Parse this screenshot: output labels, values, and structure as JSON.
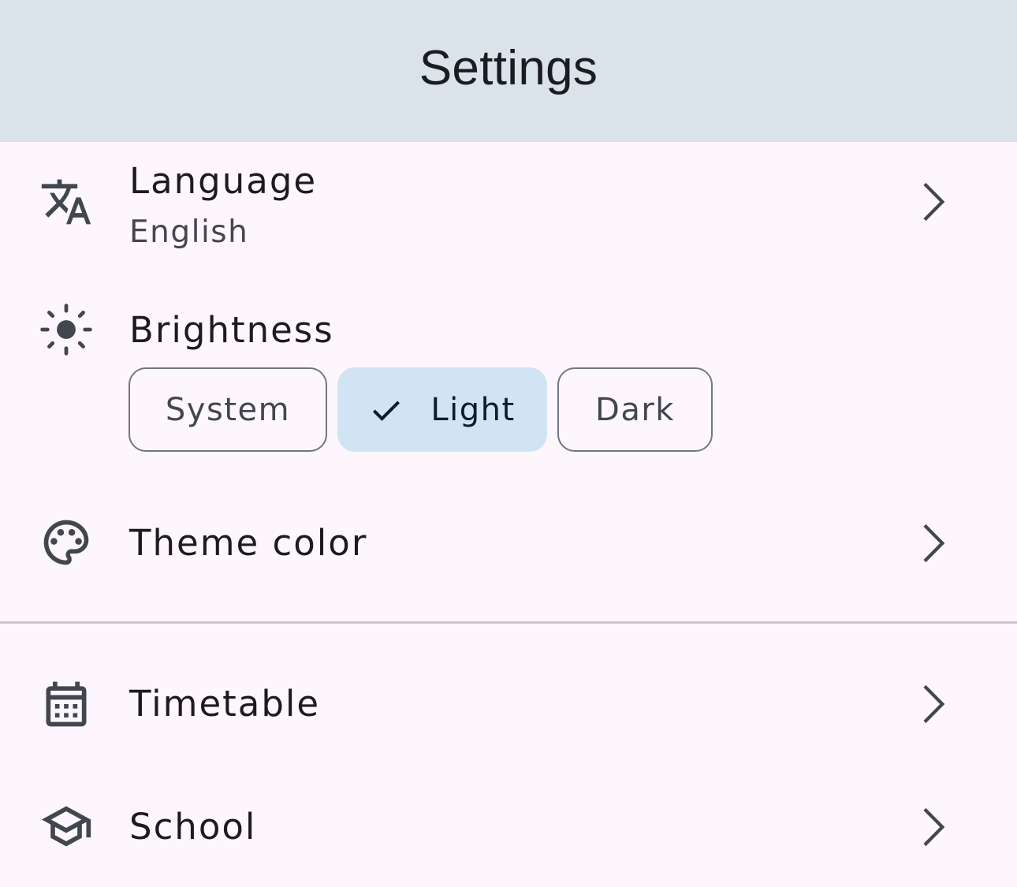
{
  "topbar": {
    "title": "Settings"
  },
  "rows": {
    "language": {
      "title": "Language",
      "subtitle": "English",
      "icon": "translate-icon"
    },
    "brightness": {
      "title": "Brightness",
      "icon": "brightness-icon"
    },
    "theme_color": {
      "title": "Theme color",
      "icon": "palette-icon"
    },
    "timetable": {
      "title": "Timetable",
      "icon": "calendar-icon"
    },
    "school": {
      "title": "School",
      "icon": "school-icon"
    }
  },
  "brightness_options": {
    "system": "System",
    "light": "Light",
    "dark": "Dark",
    "selected": "Light"
  },
  "colors": {
    "topbar_bg": "#dae2ea",
    "page_bg": "#fdf7fd",
    "selected_segment_bg": "#d1e4f3",
    "icon_color": "#41474d"
  }
}
